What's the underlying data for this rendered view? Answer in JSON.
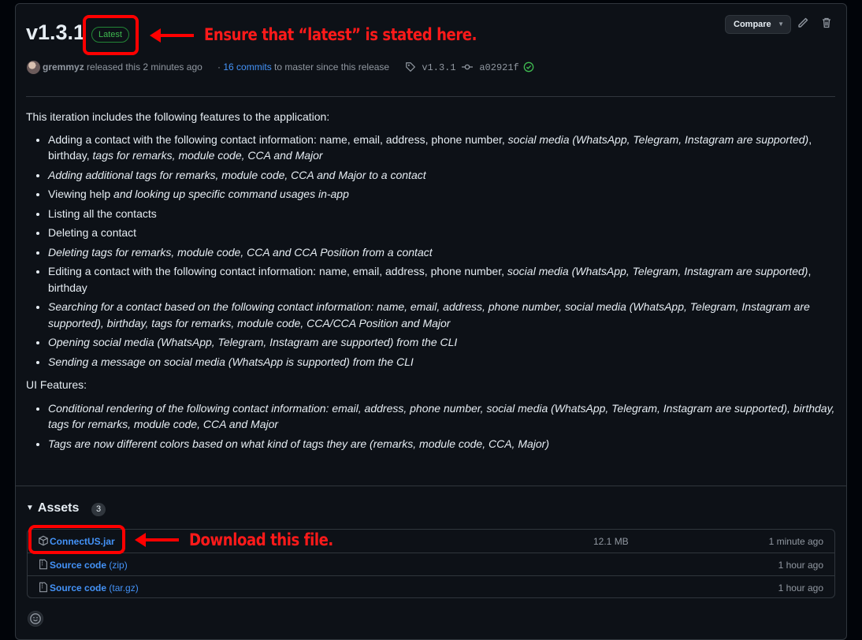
{
  "release": {
    "version": "v1.3.1",
    "badge": "Latest"
  },
  "annotations": {
    "latest_note": "Ensure that “latest” is stated here.",
    "download_note": "Download this file."
  },
  "toolbar": {
    "compare_label": "Compare"
  },
  "meta": {
    "author": "gremmyz",
    "released_text": "released this 2 minutes ago",
    "dot": "·",
    "commits_link": "16 commits",
    "commits_rest": "to master since this release",
    "tag": "v1.3.1",
    "commit": "a02921f"
  },
  "notes": {
    "intro": "This iteration includes the following features to the application:",
    "features": [
      {
        "plain": "Adding a contact with the following contact information: name, email, address, phone number, ",
        "italic": "social media (WhatsApp, Telegram, Instagram are supported)",
        "plain2": ", birthday, ",
        "italic2": "tags for remarks, module code, CCA and Major"
      },
      {
        "plain": "",
        "italic": "Adding additional tags for remarks, module code, CCA and Major to a contact",
        "plain2": "",
        "italic2": ""
      },
      {
        "plain": "Viewing help ",
        "italic": "and looking up specific command usages in-app",
        "plain2": "",
        "italic2": ""
      },
      {
        "plain": "Listing all the contacts",
        "italic": "",
        "plain2": "",
        "italic2": ""
      },
      {
        "plain": "Deleting a contact",
        "italic": "",
        "plain2": "",
        "italic2": ""
      },
      {
        "plain": "",
        "italic": "Deleting tags for remarks, module code, CCA and CCA Position from a contact",
        "plain2": "",
        "italic2": ""
      },
      {
        "plain": "Editing a contact with the following contact information: name, email, address, phone number, ",
        "italic": "social media (WhatsApp, Telegram, Instagram are supported)",
        "plain2": ", birthday",
        "italic2": ""
      },
      {
        "plain": "",
        "italic": "Searching for a contact based on the following contact information: name, email, address, phone number, social media (WhatsApp, Telegram, Instagram are supported), birthday, tags for remarks, module code, CCA/CCA Position and Major",
        "plain2": "",
        "italic2": ""
      },
      {
        "plain": "",
        "italic": "Opening social media (WhatsApp, Telegram, Instagram are supported) from the CLI",
        "plain2": "",
        "italic2": ""
      },
      {
        "plain": "",
        "italic": "Sending a message on social media (WhatsApp is supported) from the CLI",
        "plain2": "",
        "italic2": ""
      }
    ],
    "ui_heading": "UI Features:",
    "ui_features": [
      "Conditional rendering of the following contact information: email, address, phone number, social media (WhatsApp, Telegram, Instagram are supported), birthday, tags for remarks, module code, CCA and Major",
      "Tags are now different colors based on what kind of tags they are (remarks, module code, CCA, Major)"
    ]
  },
  "assets": {
    "heading": "Assets",
    "count": "3",
    "items": [
      {
        "name": "ConnectUS.jar",
        "suffix": "",
        "size": "12.1 MB",
        "time": "1 minute ago",
        "icon": "package-icon"
      },
      {
        "name": "Source code",
        "suffix": " (zip)",
        "size": "",
        "time": "1 hour ago",
        "icon": "file-zip-icon"
      },
      {
        "name": "Source code",
        "suffix": " (tar.gz)",
        "size": "",
        "time": "1 hour ago",
        "icon": "file-zip-icon"
      }
    ]
  },
  "colors": {
    "accent": "#4493f8",
    "success": "#3fb950",
    "annotation": "#ff0000",
    "background": "#0d1117"
  }
}
